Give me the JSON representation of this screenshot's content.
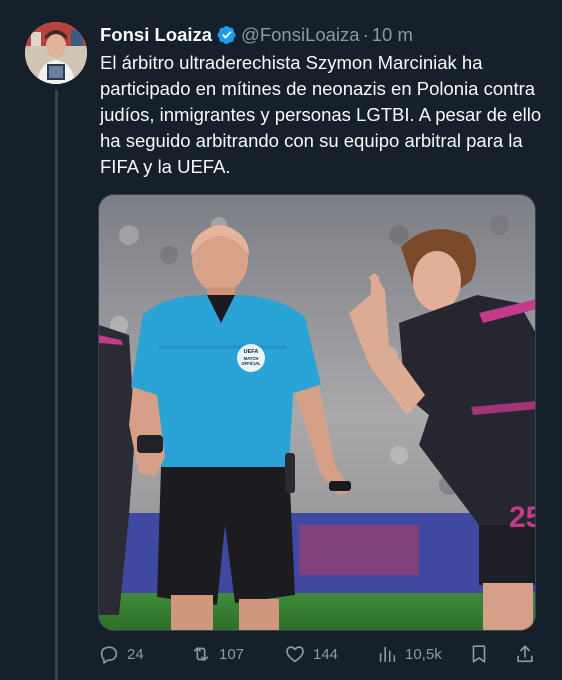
{
  "author": {
    "name": "Fonsi Loaiza",
    "handle": "@FonsiLoaiza",
    "separator": "·",
    "time": "10 m",
    "verified": true
  },
  "tweet": {
    "text": "El árbitro ultraderechista Szymon Marciniak ha participado en mítines de neonazis en Polonia contra judíos, inmigrantes y personas LGTBI. A pesar de ello ha seguido arbitrando con su equipo arbitral para la FIFA y la UEFA."
  },
  "media": {
    "badge_line1": "UEFA",
    "badge_line2": "MATCH",
    "badge_line3": "OFFICIAL",
    "shirt_number": "25"
  },
  "actions": {
    "replies": "24",
    "retweets": "107",
    "likes": "144",
    "views": "10,5k"
  },
  "colors": {
    "background": "#15202b",
    "text": "#f7f9f9",
    "muted": "#8b98a5",
    "verified": "#1d9bf0",
    "referee_shirt": "#2aa3d6"
  },
  "icons": {
    "verified": "verified-badge-icon",
    "reply": "reply-icon",
    "retweet": "retweet-icon",
    "like": "heart-icon",
    "views": "bar-chart-icon",
    "bookmark": "bookmark-icon",
    "share": "share-icon"
  }
}
